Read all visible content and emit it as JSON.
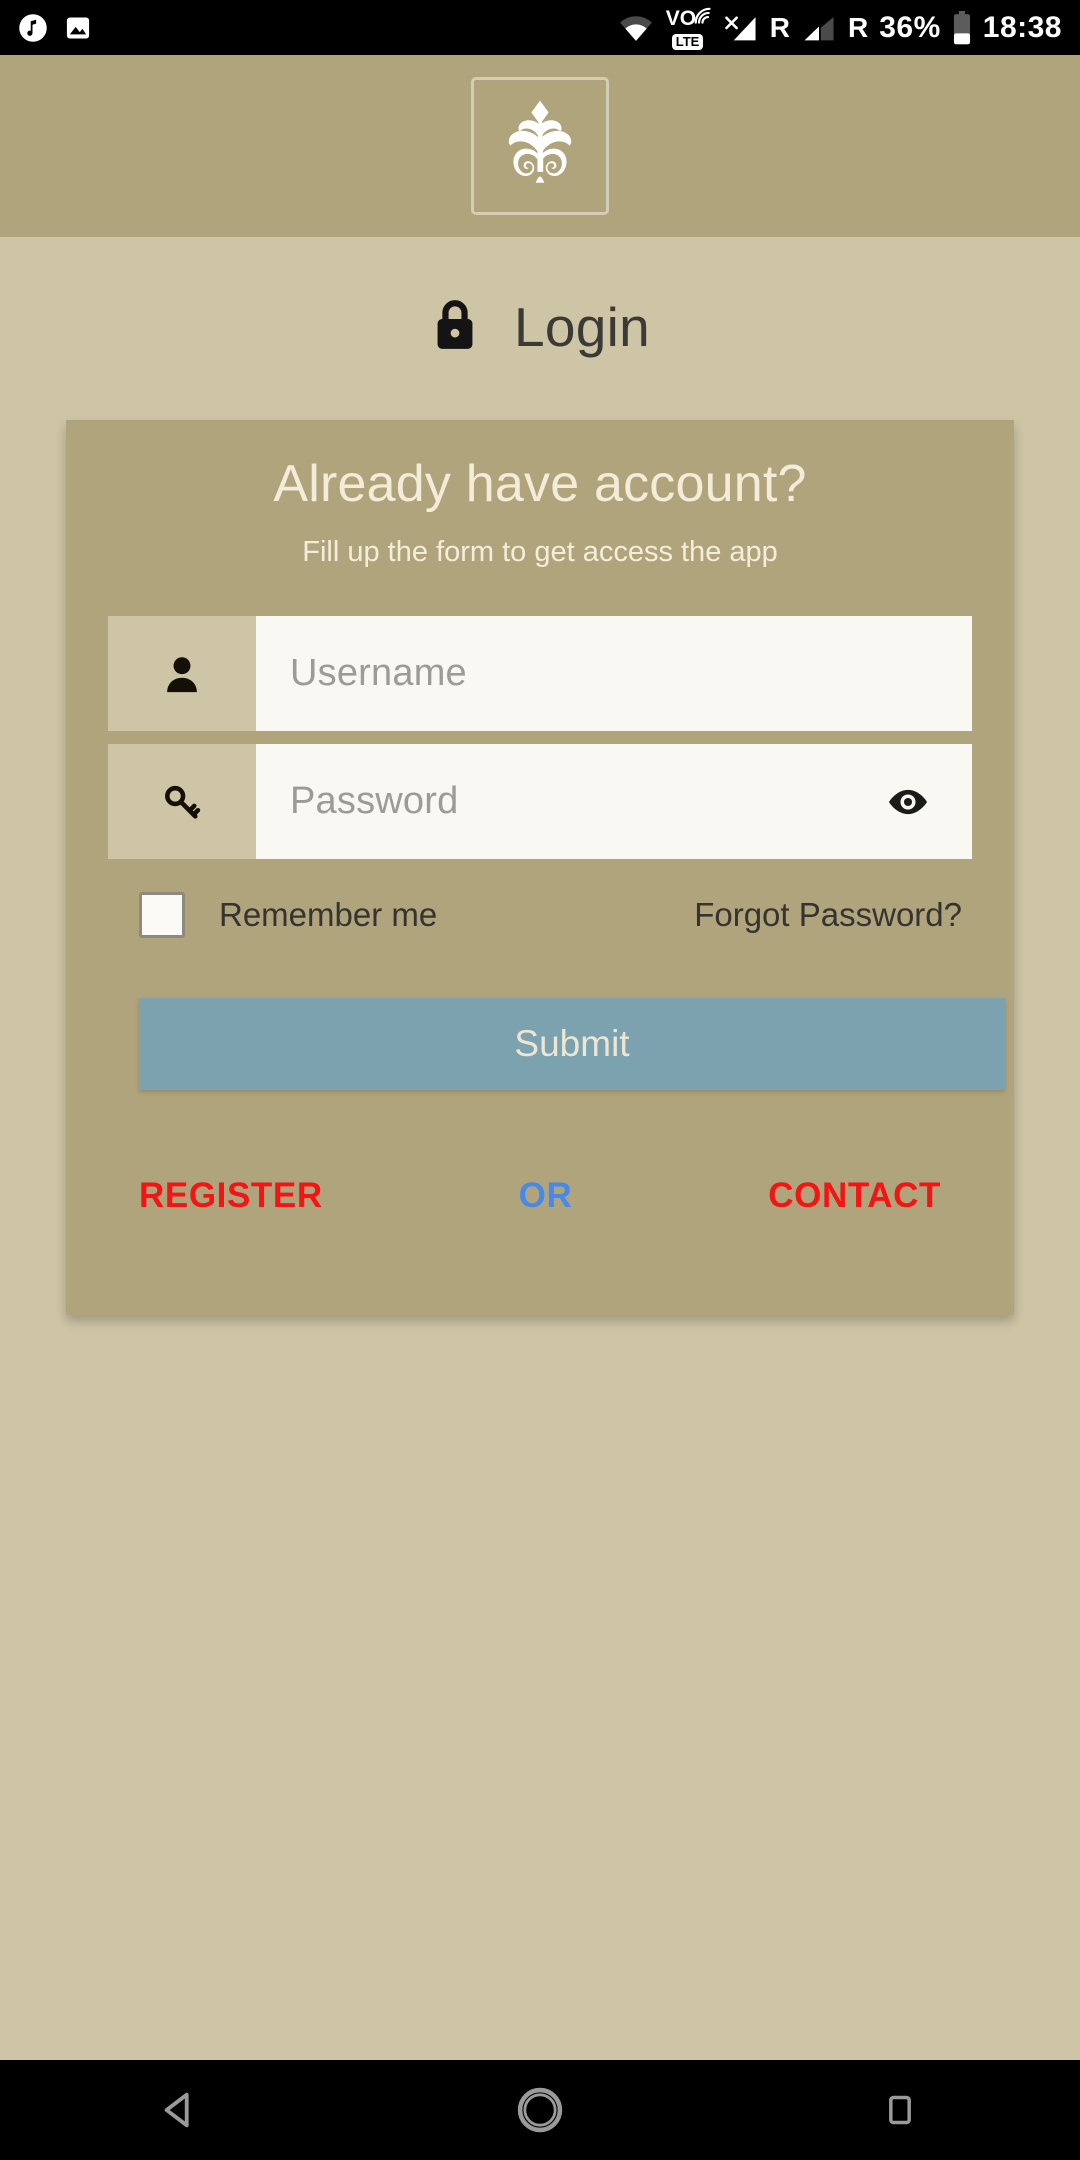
{
  "statusbar": {
    "left_icons": [
      {
        "name": "music-note-icon"
      },
      {
        "name": "image-icon"
      }
    ],
    "right_icons": [
      {
        "name": "wifi-icon"
      },
      {
        "name": "volte-icon",
        "vo_label": "VO",
        "lte_label": "LTE"
      },
      {
        "name": "signal-no-service-icon"
      },
      {
        "name": "roaming-indicator-1",
        "label": "R"
      },
      {
        "name": "signal-bars-icon"
      },
      {
        "name": "roaming-indicator-2",
        "label": "R"
      }
    ],
    "battery_percent": "36%",
    "clock": "18:38"
  },
  "header": {
    "logo_name": "app-logo-palmette"
  },
  "page": {
    "title": "Login",
    "lock_icon": "lock-icon"
  },
  "card": {
    "title": "Already have account?",
    "subtitle": "Fill up the form to get access the app",
    "fields": [
      {
        "name": "username",
        "icon": "person-icon",
        "placeholder": "Username",
        "value": ""
      },
      {
        "name": "password",
        "icon": "key-icon",
        "placeholder": "Password",
        "value": "",
        "toggle_icon": "eye-icon"
      }
    ],
    "remember_me": {
      "label": "Remember me",
      "checked": false
    },
    "forgot_password": "Forgot Password?",
    "submit_label": "Submit",
    "links": {
      "register": "REGISTER",
      "or": "OR",
      "contact": "CONTACT"
    }
  },
  "navbar": {
    "back": "back-button",
    "home": "home-button",
    "recents": "recents-button"
  },
  "colors": {
    "header_band": "#b0a47d",
    "page_background": "#cdc5a5",
    "card_background": "#b0a47d",
    "input_background": "#faf8f3",
    "submit_button": "#7ba2ae",
    "link_red": "#f41414",
    "link_blue": "#4789e8",
    "title_text": "#3b3a36",
    "card_title_text": "#f2ecd8"
  }
}
